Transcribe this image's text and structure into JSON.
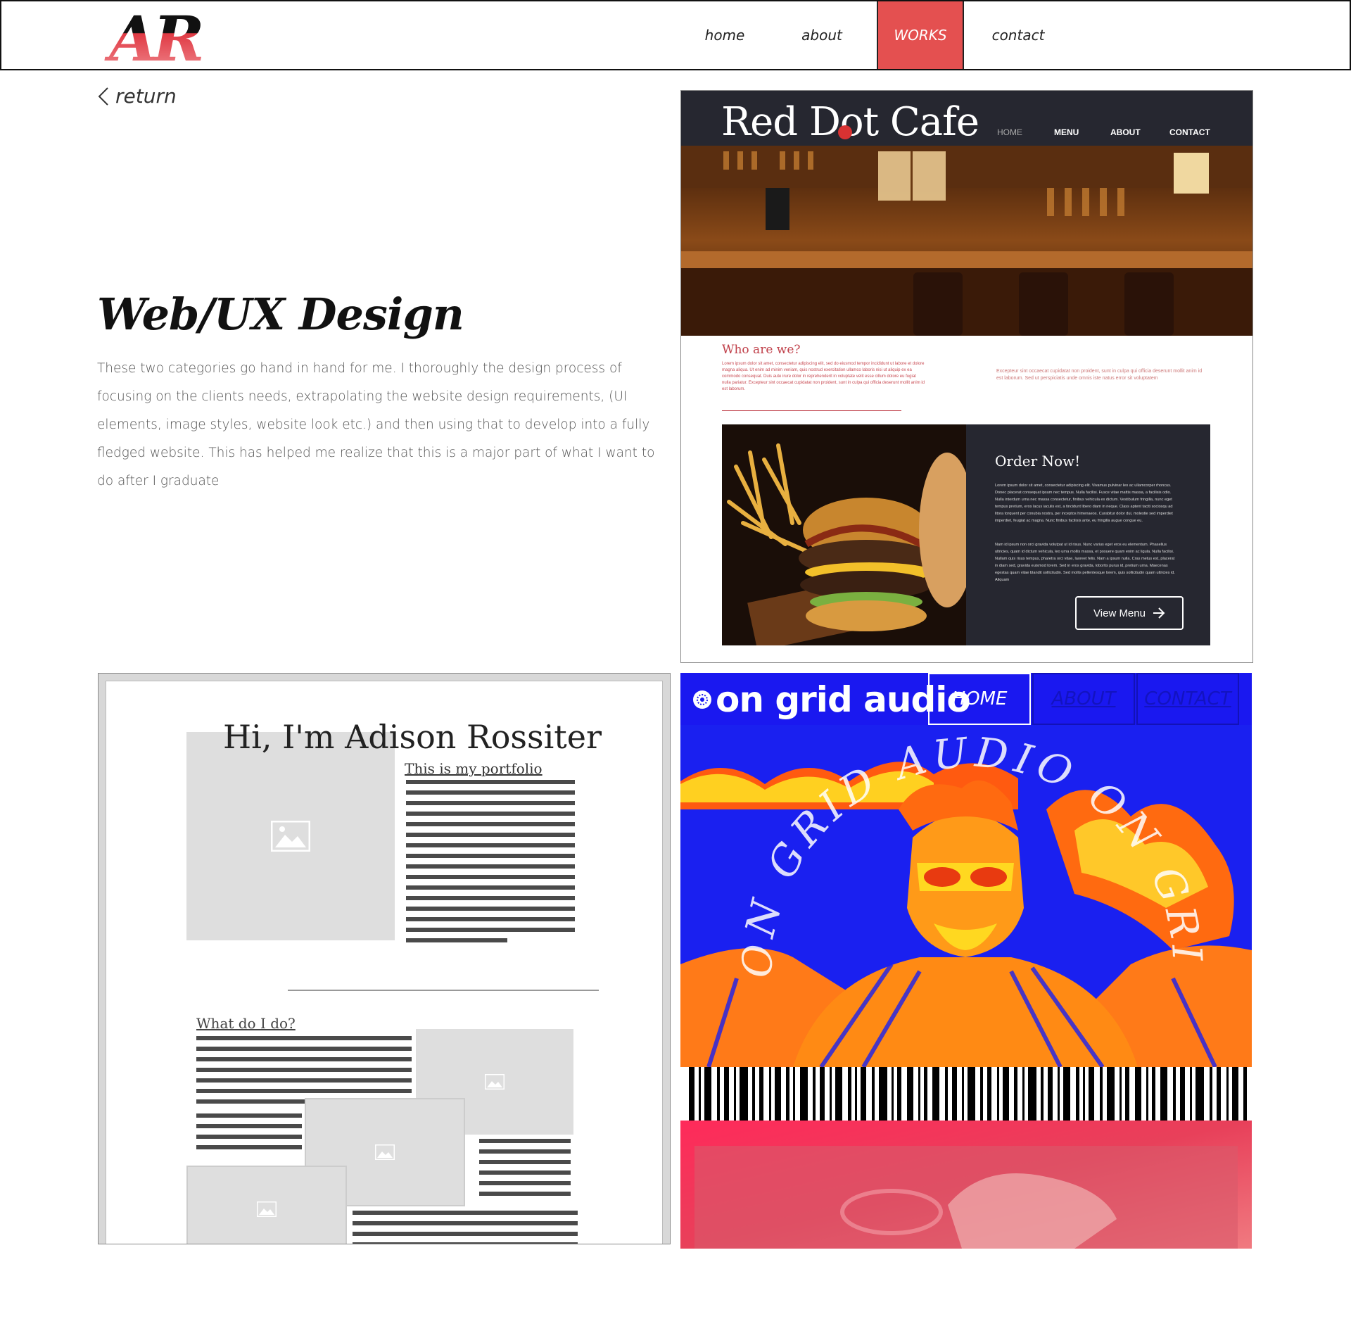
{
  "nav": {
    "logo_text": "AR",
    "items": [
      {
        "label": "home"
      },
      {
        "label": "about"
      },
      {
        "label": "WORKS"
      },
      {
        "label": "contact"
      }
    ],
    "active_color": "#e45050"
  },
  "main": {
    "return_label": "return",
    "title": "Web/UX Design",
    "description": "These two categories go hand in hand for me. I thoroughly the design process of focusing on the clients needs, extrapolating the website design requirements, (UI elements, image styles, website look etc.) and then using that to develop into a fully fledged website. This has helped me realize that this is a major part of what I want to do after I graduate"
  },
  "works": {
    "red_dot_cafe": {
      "brand": "Red Dot Cafe",
      "nav": [
        "HOME",
        "MENU",
        "ABOUT",
        "CONTACT"
      ],
      "who_title": "Who are we?",
      "who_text": "Lorem ipsum dolor sit amet, consectetur adipiscing elit, sed do eiusmod tempor incididunt ut labore et dolore magna aliqua. Ut enim ad minim veniam, quis nostrud exercitation ullamco laboris nisi ut aliquip ex ea commodo consequat. Duis aute irure dolor in reprehenderit in voluptate velit esse cillum dolore eu fugiat nulla pariatur. Excepteur sint occaecat cupidatat non proident, sunt in culpa qui officia deserunt mollit anim id est laborum.",
      "who_text_2": "Excepteur sint occaecat cupidatat non proident, sunt in culpa qui officia deserunt mollit anim id est laborum. Sed ut perspiciatis unde omnis iste natus error sit voluptatem",
      "order_title": "Order Now!",
      "order_text_1": "Lorem ipsum dolor sit amet, consectetur adipiscing elit. Vivamus pulvinar leo ac ullamcorper rhoncus. Donec placerat consequat ipsum nec tempus. Nulla facilisi. Fusce vitae mattis massa, a facilisis odio. Nulla interdum urna nec massa consectetur, finibus vehicula ex dictum. Vestibulum fringilla, nunc eget tempus pretium, eros lacus iaculis est, a tincidunt libero diam in neque. Class aptent taciti sociosqu ad litora torquent per conubia nostra, per inceptos himenaeos. Curabitur dolor dui, molestie sed imperdiet imperdiet, feugiat ac magna. Nunc finibus facilisis ante, eu fringilla augue congue eu.",
      "order_text_2": "Nam id ipsum non orci gravida volutpat ut id risus. Nunc varius eget eros eu elementum. Phasellus ultricies, quam id dictum vehicula, leo urna mollis massa, et posuere quam enim ac ligula. Nulla facilisi. Nullam quis risus tempus, pharetra orci vitae, laoreet felis. Nam a ipsum nulla. Cras metus est, placerat in diam sed, gravida euismod lorem. Sed in eros gravida, lobortis purus id, pretium urna. Maecenas egestas quam vitae blandit sollicitudin. Sed mollis pellentesque lorem, quis sollicitudin quam ultricies id. Aliquam",
      "button_label": "View Menu",
      "colors": {
        "dark": "#262730",
        "accent": "#d83232"
      }
    },
    "portfolio": {
      "heading": "Hi, I'm Adison Rossiter",
      "subheading": "This is my portfolio",
      "section_title": "What do I do?"
    },
    "on_grid_audio": {
      "brand": "on grid audio",
      "nav": [
        "HOME",
        "ABOUT",
        "CONTACT"
      ],
      "art_text": "ON GRID AUDIO ON GRID AUDIO",
      "colors": {
        "blue": "#1a18f0",
        "pink": "#e8405a"
      }
    }
  }
}
